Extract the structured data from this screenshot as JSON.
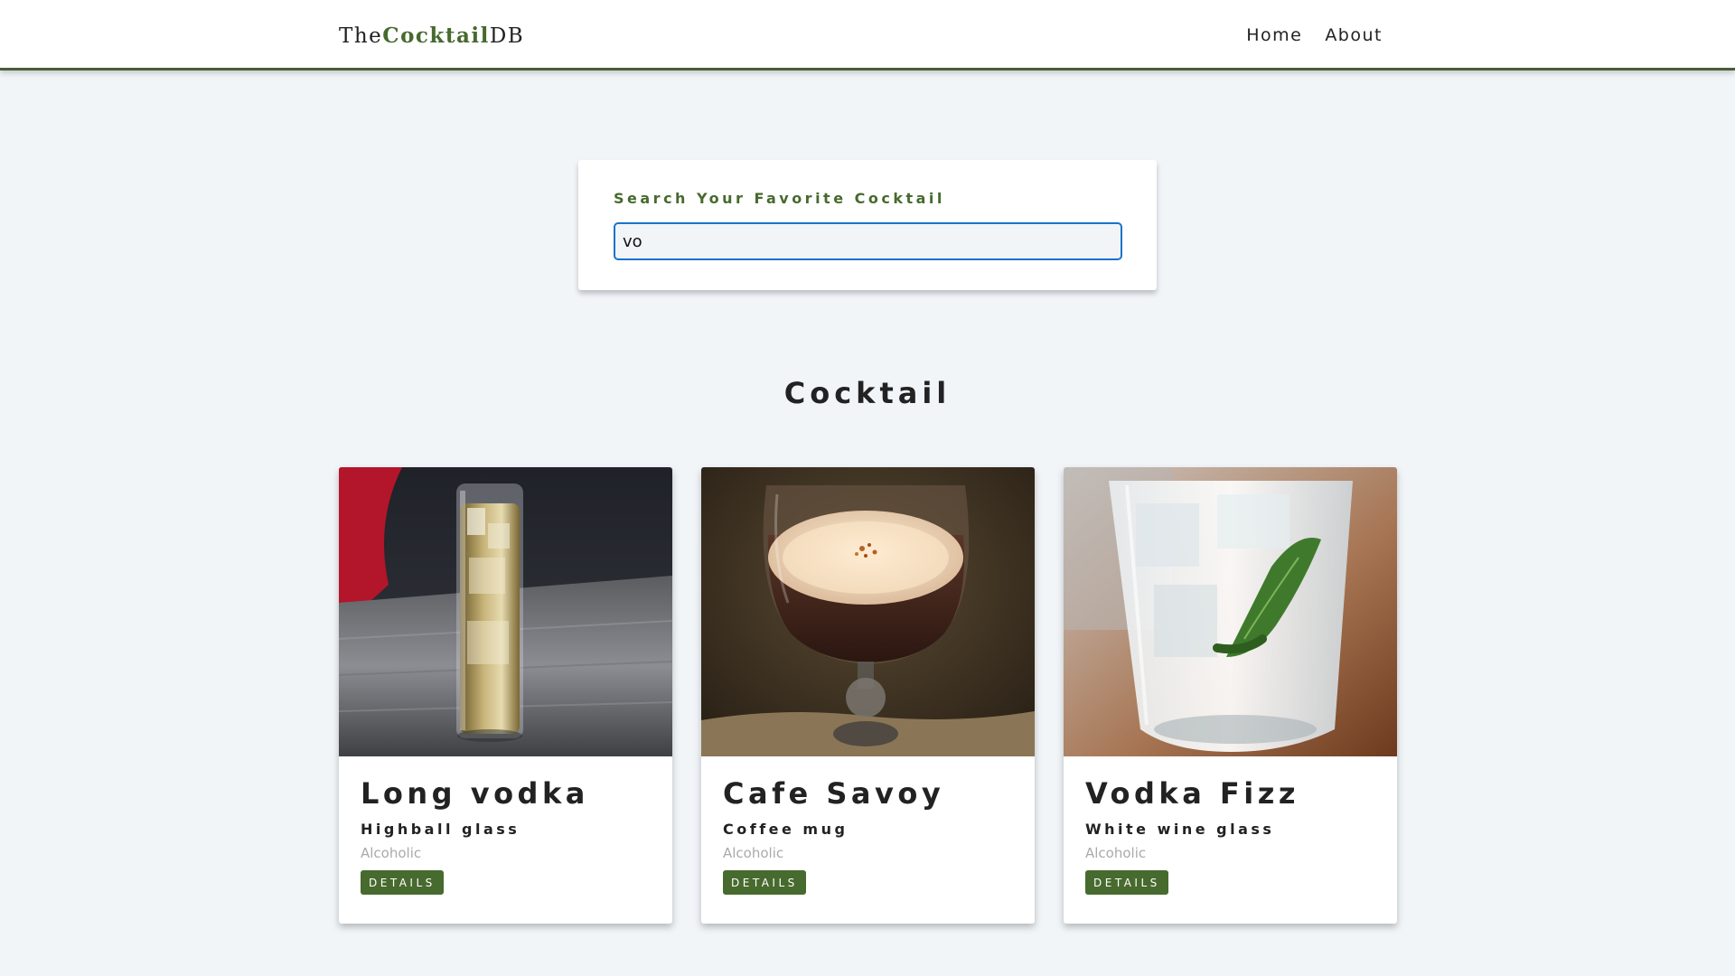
{
  "navbar": {
    "logo_prefix": "The",
    "logo_accent": "Cocktail",
    "logo_suffix": "DB",
    "links": [
      "Home",
      "About"
    ]
  },
  "search": {
    "label": "Search Your Favorite Cocktail",
    "value": "vo"
  },
  "section": {
    "title": "Cocktail"
  },
  "cocktails": [
    {
      "name": "Long vodka",
      "glass": "Highball glass",
      "type": "Alcoholic",
      "button": "DETAILS",
      "image": "highball-glass-photo"
    },
    {
      "name": "Cafe Savoy",
      "glass": "Coffee mug",
      "type": "Alcoholic",
      "button": "DETAILS",
      "image": "coffee-cocktail-photo"
    },
    {
      "name": "Vodka Fizz",
      "glass": "White wine glass",
      "type": "Alcoholic",
      "button": "DETAILS",
      "image": "mint-glass-photo"
    }
  ],
  "colors": {
    "accent": "#476a2e",
    "background": "#f1f5f8",
    "input_focus": "#1a73c9"
  }
}
